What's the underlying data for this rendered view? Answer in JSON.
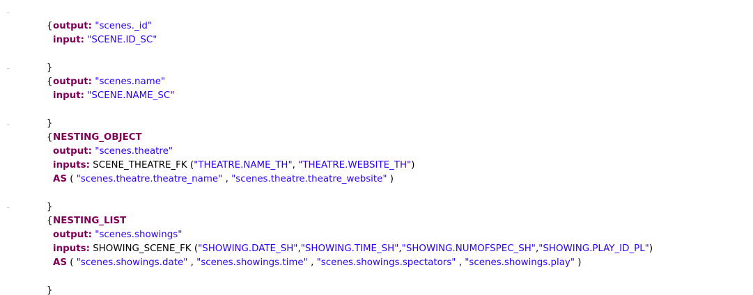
{
  "code": {
    "open_brace": "{",
    "close_brace": "}",
    "block1": {
      "output_kw": "output:",
      "output_val": "\"scenes._id\"",
      "input_kw": "input:",
      "input_val": "\"SCENE.ID_SC\""
    },
    "block2": {
      "output_kw": "output:",
      "output_val": "\"scenes.name\"",
      "input_kw": "input:",
      "input_val": "\"SCENE.NAME_SC\""
    },
    "block3": {
      "type_kw": "NESTING_OBJECT",
      "output_kw": "output:",
      "output_val": "\"scenes.theatre\"",
      "inputs_kw": "inputs:",
      "inputs_fk": "SCENE_THEATRE_FK (",
      "inputs_vals": [
        "\"THEATRE.NAME_TH\"",
        "\"THEATRE.WEBSITE_TH\""
      ],
      "as_kw": "AS",
      "as_vals": [
        "\"scenes.theatre.theatre_name\"",
        "\"scenes.theatre.theatre_website\""
      ]
    },
    "block4": {
      "type_kw": "NESTING_LIST",
      "output_kw": "output:",
      "output_val": "\"scenes.showings\"",
      "inputs_kw": "inputs:",
      "inputs_fk": "SHOWING_SCENE_FK (",
      "inputs_vals": [
        "\"SHOWING.DATE_SH\"",
        "\"SHOWING.TIME_SH\"",
        "\"SHOWING.NUMOFSPEC_SH\"",
        "\"SHOWING.PLAY_ID_PL\""
      ],
      "as_kw": "AS",
      "as_vals": [
        "\"scenes.showings.date\"",
        "\"scenes.showings.time\"",
        "\"scenes.showings.spectators\"",
        "\"scenes.showings.play\""
      ]
    }
  }
}
